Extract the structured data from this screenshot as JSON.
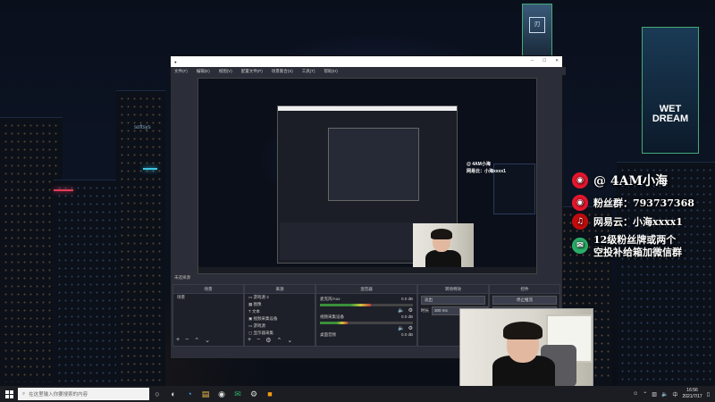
{
  "overlay": {
    "handle": "@ 4AM小海",
    "fan_group": "粉丝群：793737368",
    "netease": "网易云：小海xxxx1",
    "wechat_line1": "12级粉丝牌或两个",
    "wechat_line2": "空投补给箱加微信群",
    "colors": {
      "weibo": "#e6162d",
      "netease": "#c20c0c",
      "wechat": "#2aae67"
    }
  },
  "obs": {
    "menu": [
      "文件(F)",
      "编辑(E)",
      "视图(V)",
      "配置文件(P)",
      "场景集合(S)",
      "工具(T)",
      "帮助(H)"
    ],
    "source_selected_label": "未选择源",
    "docks": {
      "scenes_header": "场景",
      "scenes_items": [
        "场景"
      ],
      "sources_header": "来源",
      "sources_items": [
        "游戏源 2",
        "图像",
        "文本",
        "视频采集设备",
        "游戏源",
        "显示器采集"
      ],
      "mixer_header": "混音器",
      "mixer_items": [
        {
          "name": "麦克风/Aux",
          "db": "0.0 dB",
          "level": 0.55
        },
        {
          "name": "视频采集设备",
          "db": "0.0 dB",
          "level": 0.3
        },
        {
          "name": "桌面音频",
          "db": "0.0 dB",
          "level": 0.0
        }
      ],
      "transitions_header": "转场特效",
      "transition_value": "淡出",
      "duration_label": "时长",
      "duration_value": "300 ms",
      "controls_header": "控件",
      "controls_buttons": [
        "停止推流",
        "开始录制"
      ]
    }
  },
  "taskbar": {
    "search_placeholder": "在这里输入你要搜索的内容",
    "icons": [
      "task-view-icon",
      "steam-icon",
      "edge-icon",
      "file-explorer-icon",
      "obs-icon",
      "wechat-icon",
      "settings-icon",
      "app-icon"
    ],
    "time": "16:56",
    "date": "2021/7/17"
  }
}
